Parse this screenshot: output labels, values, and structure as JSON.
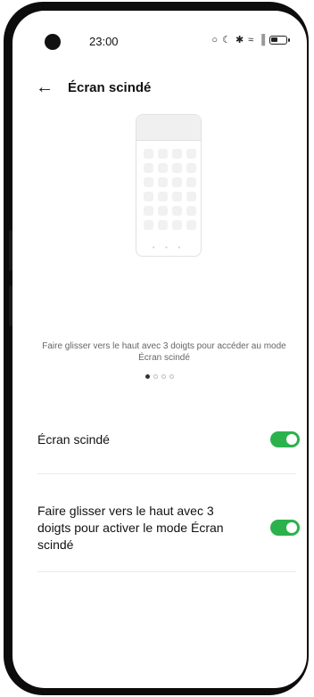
{
  "status_bar": {
    "time": "23:00",
    "icons": [
      "alarm-icon",
      "moon-icon",
      "bluetooth-icon",
      "wifi-icon",
      "signal-icon",
      "battery-icon"
    ]
  },
  "header": {
    "title": "Écran scindé",
    "back_icon": "arrow-left-icon"
  },
  "illustration": {
    "caption": "Faire glisser vers le haut avec 3 doigts pour accéder au mode Écran scindé"
  },
  "pager": {
    "count": 4,
    "active_index": 0
  },
  "settings": [
    {
      "label": "Écran scindé",
      "enabled": true
    },
    {
      "label": "Faire glisser vers le haut avec 3 doigts pour activer le mode Écran scindé",
      "enabled": true
    }
  ],
  "colors": {
    "toggle_on": "#2bb24c",
    "text_primary": "#111111",
    "text_secondary": "#666666"
  }
}
